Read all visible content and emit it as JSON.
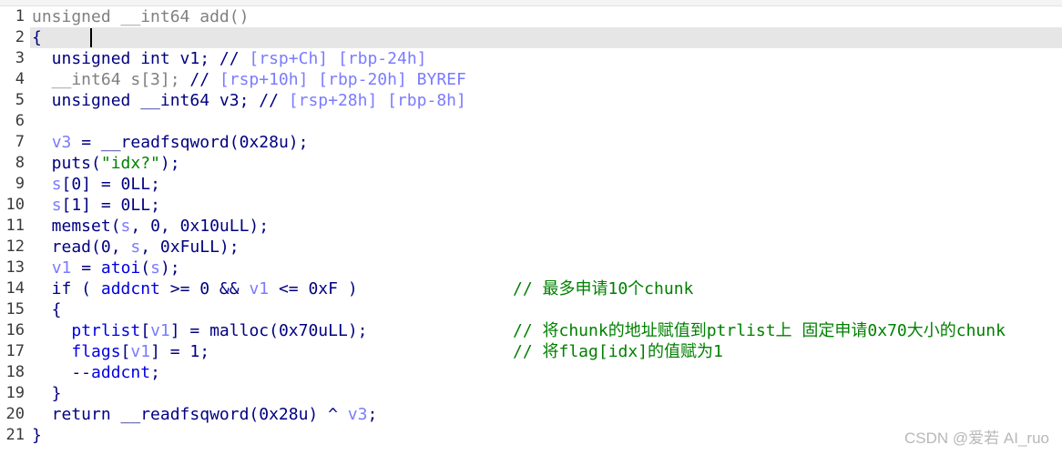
{
  "editor": {
    "current_line": 2,
    "lines": [
      {
        "n": "1",
        "tokens": [
          {
            "t": "unsigned __int64 add()",
            "c": "gr"
          }
        ]
      },
      {
        "n": "2",
        "tokens": [
          {
            "t": "{",
            "c": "k"
          }
        ]
      },
      {
        "n": "3",
        "tokens": [
          {
            "t": "  unsigned int v1; // ",
            "c": "k"
          },
          {
            "t": "[rsp+Ch] [rbp-24h]",
            "c": "c"
          }
        ]
      },
      {
        "n": "4",
        "tokens": [
          {
            "t": "  __int64 s[3]; ",
            "c": "gr"
          },
          {
            "t": "// ",
            "c": "k"
          },
          {
            "t": "[rsp+10h] [rbp-20h] BYREF",
            "c": "c"
          }
        ]
      },
      {
        "n": "5",
        "tokens": [
          {
            "t": "  unsigned __int64 v3; // ",
            "c": "k"
          },
          {
            "t": "[rsp+28h] [rbp-8h]",
            "c": "c"
          }
        ]
      },
      {
        "n": "6",
        "tokens": []
      },
      {
        "n": "7",
        "tokens": [
          {
            "t": "  ",
            "c": "k"
          },
          {
            "t": "v3",
            "c": "v"
          },
          {
            "t": " = __readfsqword(0x28u);",
            "c": "k"
          }
        ]
      },
      {
        "n": "8",
        "tokens": [
          {
            "t": "  puts(",
            "c": "k"
          },
          {
            "t": "\"idx?\"",
            "c": "s"
          },
          {
            "t": ");",
            "c": "k"
          }
        ]
      },
      {
        "n": "9",
        "tokens": [
          {
            "t": "  ",
            "c": "k"
          },
          {
            "t": "s",
            "c": "v"
          },
          {
            "t": "[0] = 0LL;",
            "c": "k"
          }
        ]
      },
      {
        "n": "10",
        "tokens": [
          {
            "t": "  ",
            "c": "k"
          },
          {
            "t": "s",
            "c": "v"
          },
          {
            "t": "[1] = 0LL;",
            "c": "k"
          }
        ]
      },
      {
        "n": "11",
        "tokens": [
          {
            "t": "  memset(",
            "c": "k"
          },
          {
            "t": "s",
            "c": "v"
          },
          {
            "t": ", 0, 0x10uLL);",
            "c": "k"
          }
        ]
      },
      {
        "n": "12",
        "tokens": [
          {
            "t": "  read(0, ",
            "c": "k"
          },
          {
            "t": "s",
            "c": "v"
          },
          {
            "t": ", 0xFuLL);",
            "c": "k"
          }
        ]
      },
      {
        "n": "13",
        "tokens": [
          {
            "t": "  ",
            "c": "k"
          },
          {
            "t": "v1",
            "c": "v"
          },
          {
            "t": " = ",
            "c": "k"
          },
          {
            "t": "atoi",
            "c": "g"
          },
          {
            "t": "(",
            "c": "k"
          },
          {
            "t": "s",
            "c": "v"
          },
          {
            "t": ");",
            "c": "k"
          }
        ]
      },
      {
        "n": "14",
        "tokens": [
          {
            "t": "  if ( ",
            "c": "k"
          },
          {
            "t": "addcnt",
            "c": "g"
          },
          {
            "t": " >= 0 && ",
            "c": "k"
          },
          {
            "t": "v1",
            "c": "v"
          },
          {
            "t": " <= 0xF )",
            "c": "k"
          }
        ],
        "comment": "// 最多申请10个chunk"
      },
      {
        "n": "15",
        "tokens": [
          {
            "t": "  {",
            "c": "k"
          }
        ]
      },
      {
        "n": "16",
        "tokens": [
          {
            "t": "    ",
            "c": "k"
          },
          {
            "t": "ptrlist",
            "c": "g"
          },
          {
            "t": "[",
            "c": "k"
          },
          {
            "t": "v1",
            "c": "v"
          },
          {
            "t": "] = malloc(0x70uLL);",
            "c": "k"
          }
        ],
        "comment": "// 将chunk的地址赋值到ptrlist上 固定申请0x70大小的chunk"
      },
      {
        "n": "17",
        "tokens": [
          {
            "t": "    ",
            "c": "k"
          },
          {
            "t": "flags",
            "c": "g"
          },
          {
            "t": "[",
            "c": "k"
          },
          {
            "t": "v1",
            "c": "v"
          },
          {
            "t": "] = 1;",
            "c": "k"
          }
        ],
        "comment": "// 将flag[idx]的值赋为1"
      },
      {
        "n": "18",
        "tokens": [
          {
            "t": "    --",
            "c": "k"
          },
          {
            "t": "addcnt",
            "c": "g"
          },
          {
            "t": ";",
            "c": "k"
          }
        ]
      },
      {
        "n": "19",
        "tokens": [
          {
            "t": "  }",
            "c": "k"
          }
        ]
      },
      {
        "n": "20",
        "tokens": [
          {
            "t": "  return __readfsqword(0x28u) ^ ",
            "c": "k"
          },
          {
            "t": "v3",
            "c": "v"
          },
          {
            "t": ";",
            "c": "k"
          }
        ]
      },
      {
        "n": "21",
        "tokens": [
          {
            "t": "}",
            "c": "k"
          }
        ]
      }
    ]
  },
  "watermark": "CSDN @爱若 AI_ruo"
}
